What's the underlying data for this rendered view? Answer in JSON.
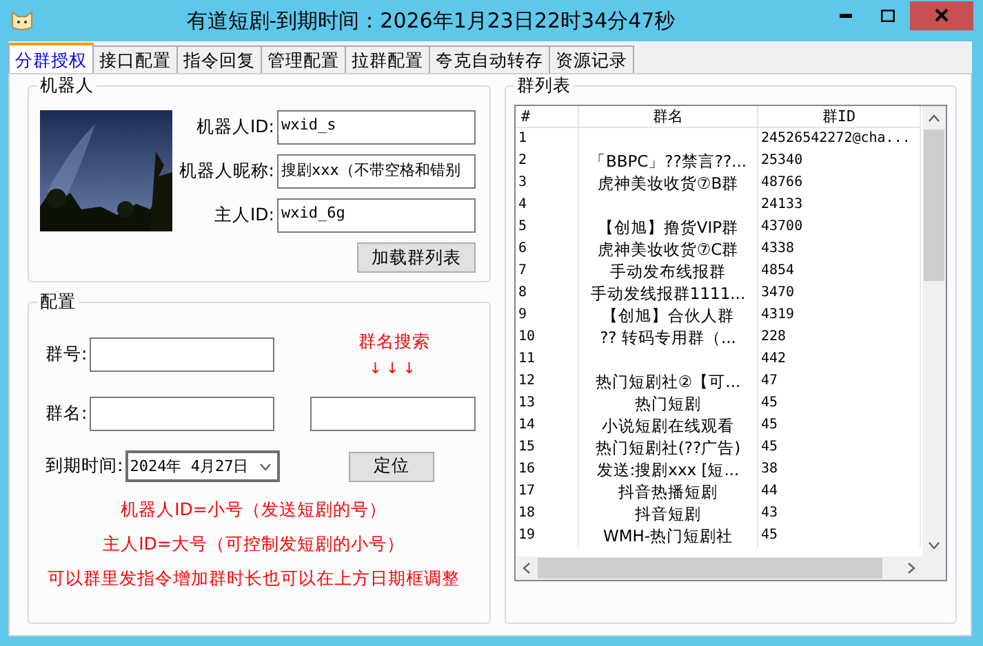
{
  "window": {
    "title": "有道短剧-到期时间：2026年1月23日22时34分47秒"
  },
  "tabs": [
    {
      "label": "分群授权",
      "selected": true
    },
    {
      "label": "接口配置",
      "selected": false
    },
    {
      "label": "指令回复",
      "selected": false
    },
    {
      "label": "管理配置",
      "selected": false
    },
    {
      "label": "拉群配置",
      "selected": false
    },
    {
      "label": "夸克自动转存",
      "selected": false
    },
    {
      "label": "资源记录",
      "selected": false
    }
  ],
  "robot": {
    "title": "机器人",
    "fields": [
      {
        "label": "机器人ID:",
        "value": "wxid_s"
      },
      {
        "label": "机器人昵称:",
        "value": "搜剧xxx（不带空格和错别"
      },
      {
        "label": "主人ID:",
        "value": "wxid_6g"
      }
    ],
    "load_button": "加载群列表"
  },
  "config": {
    "title": "配置",
    "group_number_label": "群号:",
    "group_name_label": "群名:",
    "search_label": "群名搜索",
    "search_arrows": "↓↓↓",
    "expiry_label": "到期时间:",
    "expiry_value": "2024年 4月27日",
    "locate_button": "定位",
    "notes": [
      "机器人ID=小号（发送短剧的号）",
      "主人ID=大号（可控制发短剧的小号）",
      "可以群里发指令增加群时长也可以在上方日期框调整"
    ]
  },
  "group_list": {
    "title": "群列表",
    "columns": [
      "#",
      "群名",
      "群ID"
    ],
    "rows": [
      [
        "1",
        "",
        "24526542272@cha..."
      ],
      [
        "2",
        "「BBPC」??禁言??...",
        "25340"
      ],
      [
        "3",
        "虎神美妆收货⑦B群",
        "48766"
      ],
      [
        "4",
        "",
        "24133"
      ],
      [
        "5",
        "【创旭】撸货VIP群",
        "43700"
      ],
      [
        "6",
        "虎神美妆收货⑦C群",
        "4338"
      ],
      [
        "7",
        "手动发布线报群",
        "4854"
      ],
      [
        "8",
        "手动发线报群1111...",
        "3470"
      ],
      [
        "9",
        "【创旭】合伙人群",
        "4319"
      ],
      [
        "10",
        "?? 转码专用群（...",
        "228"
      ],
      [
        "11",
        "",
        "442"
      ],
      [
        "12",
        "热门短剧社②【可...",
        "47"
      ],
      [
        "13",
        "热门短剧",
        "45"
      ],
      [
        "14",
        "小说短剧在线观看",
        "45"
      ],
      [
        "15",
        "热门短剧社(??广告)",
        "45"
      ],
      [
        "16",
        "发送:搜剧xxx [短...",
        "38"
      ],
      [
        "17",
        "抖音热播短剧",
        "44"
      ],
      [
        "18",
        "抖音短剧",
        "43"
      ],
      [
        "19",
        "WMH-热门短剧社",
        "45"
      ]
    ]
  }
}
